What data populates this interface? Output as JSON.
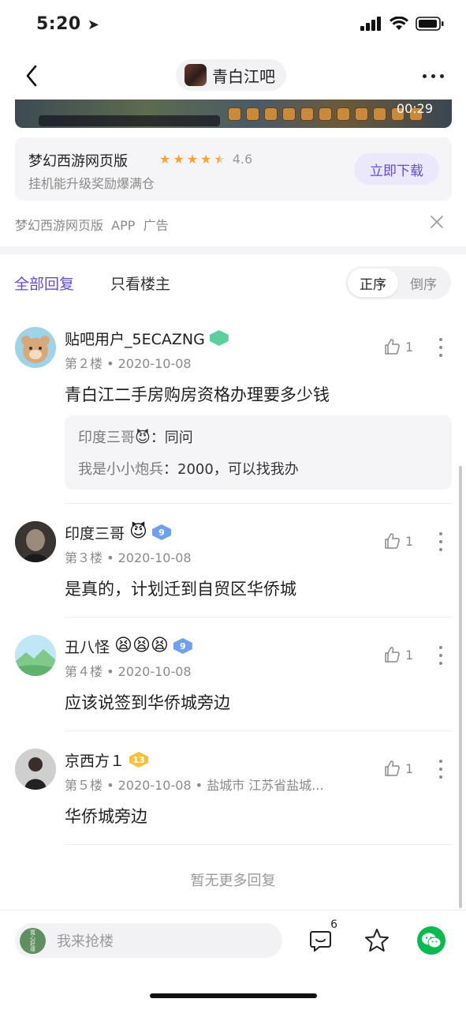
{
  "status": {
    "time": "5:20"
  },
  "nav": {
    "title": "青白江吧"
  },
  "ad": {
    "video_time": "00:29",
    "title": "梦幻西游网页版",
    "rating": "4.6",
    "rating_value": 4.6,
    "subtitle": "挂机能升级奖励爆满仓",
    "download_label": "立即下载",
    "footer": "梦幻西游网页版  APP  广告"
  },
  "tabs": {
    "all": "全部回复",
    "owner_only": "只看楼主"
  },
  "order": {
    "asc": "正序",
    "desc": "倒序"
  },
  "replies": [
    {
      "name": "贴吧用户_5ECAZNG",
      "badge_level": "",
      "meta": "第２楼 • 2020-10-08",
      "content": "青白江二手房购房资格办理要多少钱",
      "likes": "1",
      "sub_replies": [
        {
          "who": "印度三哥",
          "emoji": "😈",
          "text": "：同问"
        },
        {
          "who": "我是小小炮兵",
          "text": "：2000，可以找我办"
        }
      ]
    },
    {
      "name": "印度三哥",
      "emoji": "😈",
      "badge_level": "9",
      "meta": "第３楼 • 2020-10-08",
      "content": "是真的，计划迁到自贸区华侨城",
      "likes": "1"
    },
    {
      "name": "丑八怪",
      "emoji": "😫😫😫",
      "badge_level": "9",
      "meta": "第４楼 • 2020-10-08",
      "content": "应该说签到华侨城旁边",
      "likes": "1"
    },
    {
      "name": "京西方１",
      "badge_level": "13",
      "meta": "第５楼 • 2020-10-08 • 盐城市 江苏省盐城...",
      "content": "华侨城旁边",
      "likes": "1"
    }
  ],
  "no_more": "暂无更多回复",
  "bottom": {
    "input_placeholder": "我来抢楼",
    "avatar_text": "寬心好運",
    "comment_count": "6"
  }
}
